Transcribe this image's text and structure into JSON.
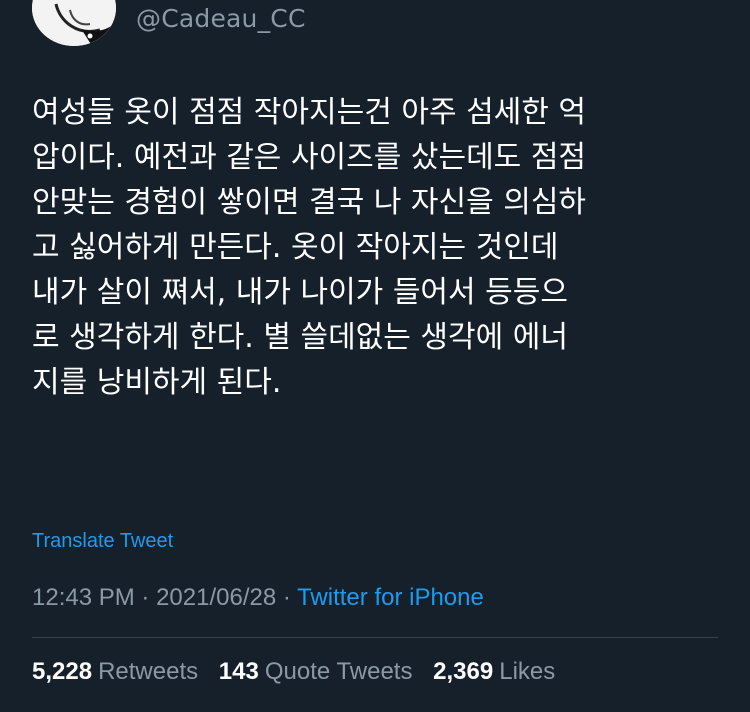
{
  "tweet": {
    "handle": "@Cadeau_CC",
    "text": "여성들 옷이 점점 작아지는건 아주 섬세한 억\n압이다. 예전과 같은 사이즈를 샀는데도 점점\n안맞는 경험이 쌓이면 결국 나 자신을 의심하\n고 싫어하게 만든다. 옷이 작아지는 것인데\n내가 살이 쪄서, 내가 나이가 들어서 등등으\n로 생각하게 한다. 별 쓸데없는 생각에 에너\n지를 낭비하게 된다.",
    "translate_label": "Translate Tweet",
    "time": "12:43 PM",
    "date": "2021/06/28",
    "separator": " · ",
    "source": "Twitter for iPhone"
  },
  "stats": {
    "retweets_count": "5,228",
    "retweets_label": "Retweets",
    "quotes_count": "143",
    "quotes_label": "Quote Tweets",
    "likes_count": "2,369",
    "likes_label": "Likes"
  },
  "colors": {
    "background": "#15202b",
    "text": "#ffffff",
    "muted": "#8b98a5",
    "accent": "#1d9bf0",
    "divider": "#38444d"
  },
  "icons": {
    "avatar": "profile-avatar-illustration"
  }
}
